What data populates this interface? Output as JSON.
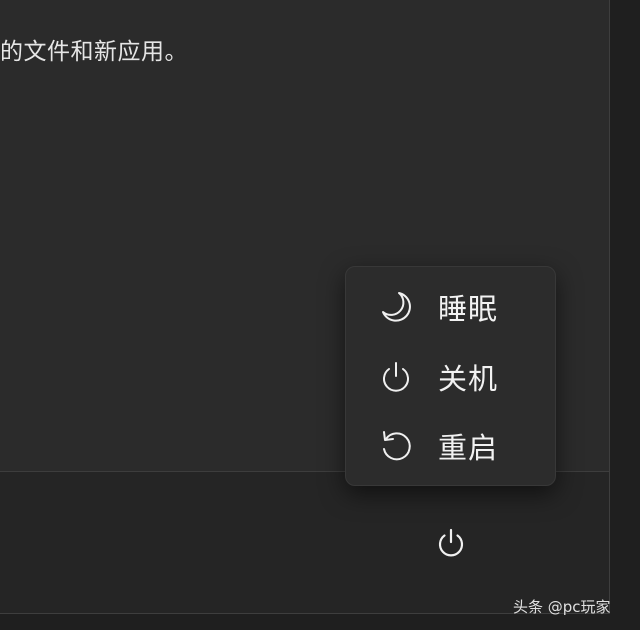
{
  "panel": {
    "text": "的文件和新应用。"
  },
  "power_menu": {
    "items": [
      {
        "label": "睡眠",
        "icon": "moon-icon"
      },
      {
        "label": "关机",
        "icon": "power-icon"
      },
      {
        "label": "重启",
        "icon": "restart-icon"
      }
    ]
  },
  "footer": {
    "power_icon": "power-icon"
  },
  "watermark": {
    "text": "头条 @pc玩家"
  }
}
